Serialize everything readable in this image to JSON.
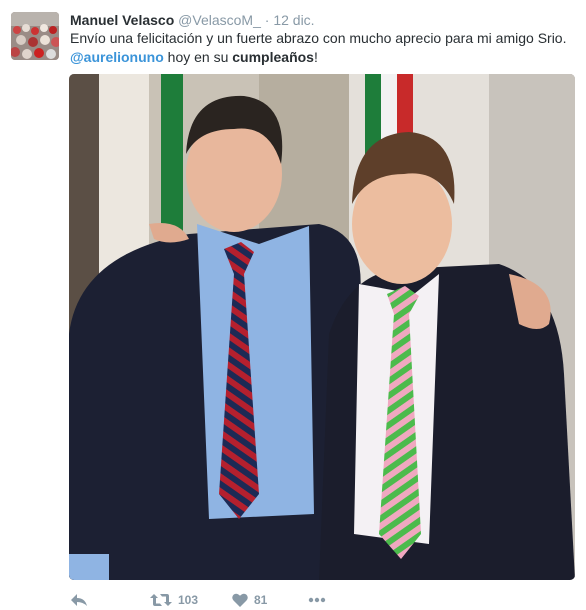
{
  "tweet": {
    "author": {
      "fullname": "Manuel Velasco",
      "screen_name": "@VelascoM_",
      "separator": "·",
      "time": "12 dic."
    },
    "text": {
      "part1": "Envío una felicitación y un fuerte abrazo con mucho aprecio para mi amigo Srio. ",
      "mention": "@aurelionuno",
      "part2": " hoy en su ",
      "bold_word": "cumpleaños",
      "part3": "!"
    },
    "actions": {
      "retweet_count": "103",
      "like_count": "81"
    },
    "colors": {
      "link": "#3b94d9",
      "muted": "#8899a6",
      "text": "#292f33"
    },
    "icons": {
      "reply": "reply-icon",
      "retweet": "retweet-icon",
      "like": "heart-icon",
      "more": "more-icon"
    }
  }
}
